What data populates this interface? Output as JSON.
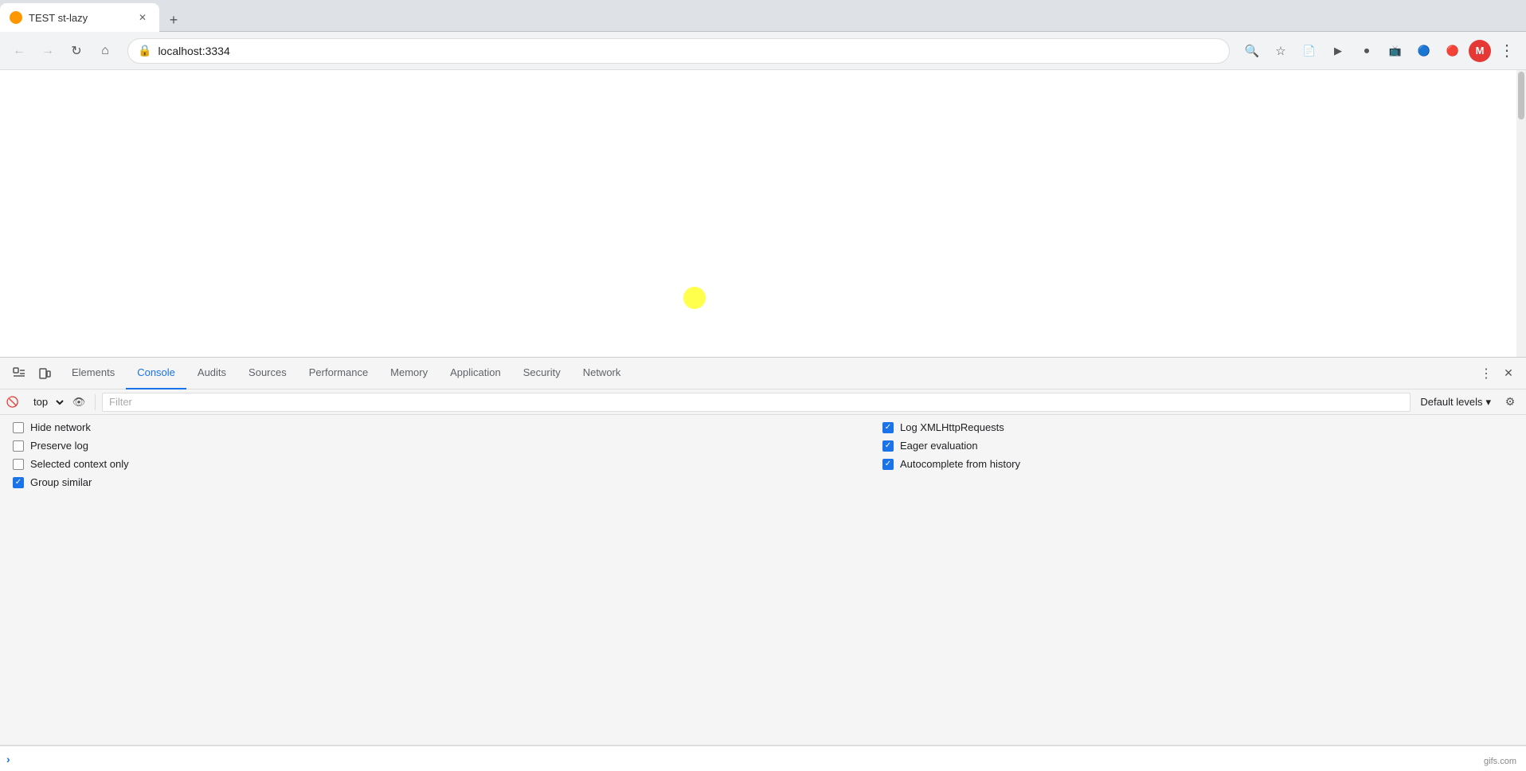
{
  "browser": {
    "tab": {
      "favicon_color": "#ff9800",
      "title": "TEST st-lazy",
      "close_icon": "✕"
    },
    "new_tab_icon": "+",
    "nav": {
      "back_icon": "←",
      "forward_icon": "→",
      "reload_icon": "↻",
      "home_icon": "⌂",
      "url": "localhost:3334",
      "search_icon": "🔍",
      "bookmark_icon": "☆",
      "more_icon": "⋮"
    }
  },
  "devtools": {
    "tabs": [
      {
        "label": "Elements",
        "active": false
      },
      {
        "label": "Console",
        "active": true
      },
      {
        "label": "Audits",
        "active": false
      },
      {
        "label": "Sources",
        "active": false
      },
      {
        "label": "Performance",
        "active": false
      },
      {
        "label": "Memory",
        "active": false
      },
      {
        "label": "Application",
        "active": false
      },
      {
        "label": "Security",
        "active": false
      },
      {
        "label": "Network",
        "active": false
      }
    ],
    "console": {
      "context": "top",
      "filter_placeholder": "Filter",
      "levels": "Default levels",
      "settings": {
        "left": [
          {
            "label": "Hide network",
            "checked": false
          },
          {
            "label": "Preserve log",
            "checked": false
          },
          {
            "label": "Selected context only",
            "checked": false
          },
          {
            "label": "Group similar",
            "checked": true
          }
        ],
        "right": [
          {
            "label": "Log XMLHttpRequests",
            "checked": true
          },
          {
            "label": "Eager evaluation",
            "checked": true
          },
          {
            "label": "Autocomplete from history",
            "checked": true
          }
        ]
      }
    }
  },
  "watermark": "gifs.com"
}
